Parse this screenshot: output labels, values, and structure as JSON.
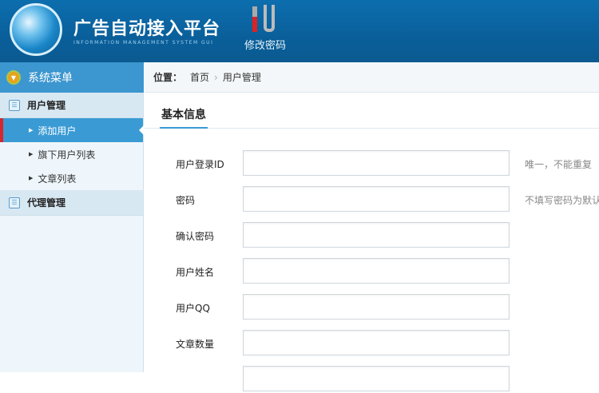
{
  "header": {
    "title": "广告自动接入平台",
    "subtitle": "INFORMATION MANAGEMENT SYSTEM GUI",
    "tool_label": "修改密码"
  },
  "sidebar": {
    "title": "系统菜单",
    "sections": [
      {
        "label": "用户管理",
        "items": [
          "添加用户",
          "旗下用户列表",
          "文章列表"
        ]
      },
      {
        "label": "代理管理"
      }
    ]
  },
  "breadcrumb": {
    "label": "位置：",
    "items": [
      "首页",
      "用户管理"
    ]
  },
  "tab": "基本信息",
  "form": [
    {
      "label": "用户登录ID",
      "value": "",
      "hint": "唯一，不能重复"
    },
    {
      "label": "密码",
      "value": "",
      "hint": "不填写密码为默认"
    },
    {
      "label": "确认密码",
      "value": ""
    },
    {
      "label": "用户姓名",
      "value": ""
    },
    {
      "label": "用户QQ",
      "value": ""
    },
    {
      "label": "文章数量",
      "value": ""
    },
    {
      "value": ""
    }
  ]
}
